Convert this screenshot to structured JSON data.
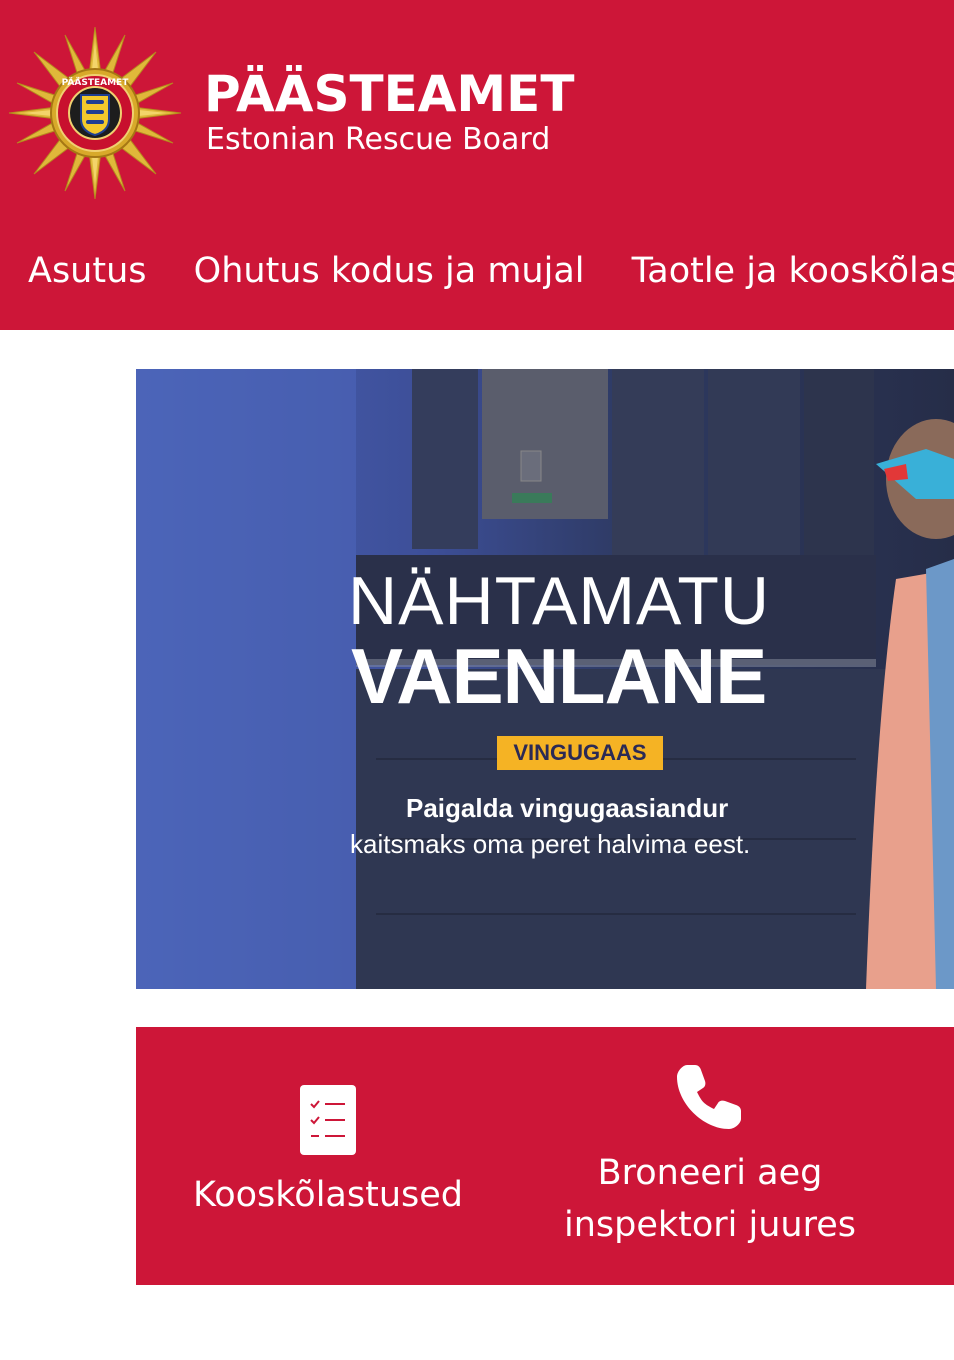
{
  "header": {
    "logo_text": "PÄÄSTEAMET",
    "title": "PÄÄSTEAMET",
    "subtitle": "Estonian Rescue Board",
    "bg_color": "#cd1638"
  },
  "nav": {
    "items": [
      {
        "label": "Asutus"
      },
      {
        "label": "Ohutus kodus ja mujal"
      },
      {
        "label": "Taotle ja kooskõlas"
      }
    ]
  },
  "banner": {
    "line1": "NÄHTAMATU",
    "line2": "VAENLANE",
    "badge": "VINGUGAAS",
    "text_bold": "Paigalda vingugaasiandur",
    "text_normal": "kaitsmaks oma peret halvima eest."
  },
  "quick_links": [
    {
      "label": "Kooskõlastused",
      "icon": "checklist-icon"
    },
    {
      "label_line1": "Broneeri aeg",
      "label_line2": "inspektori juures",
      "icon": "phone-icon"
    }
  ]
}
